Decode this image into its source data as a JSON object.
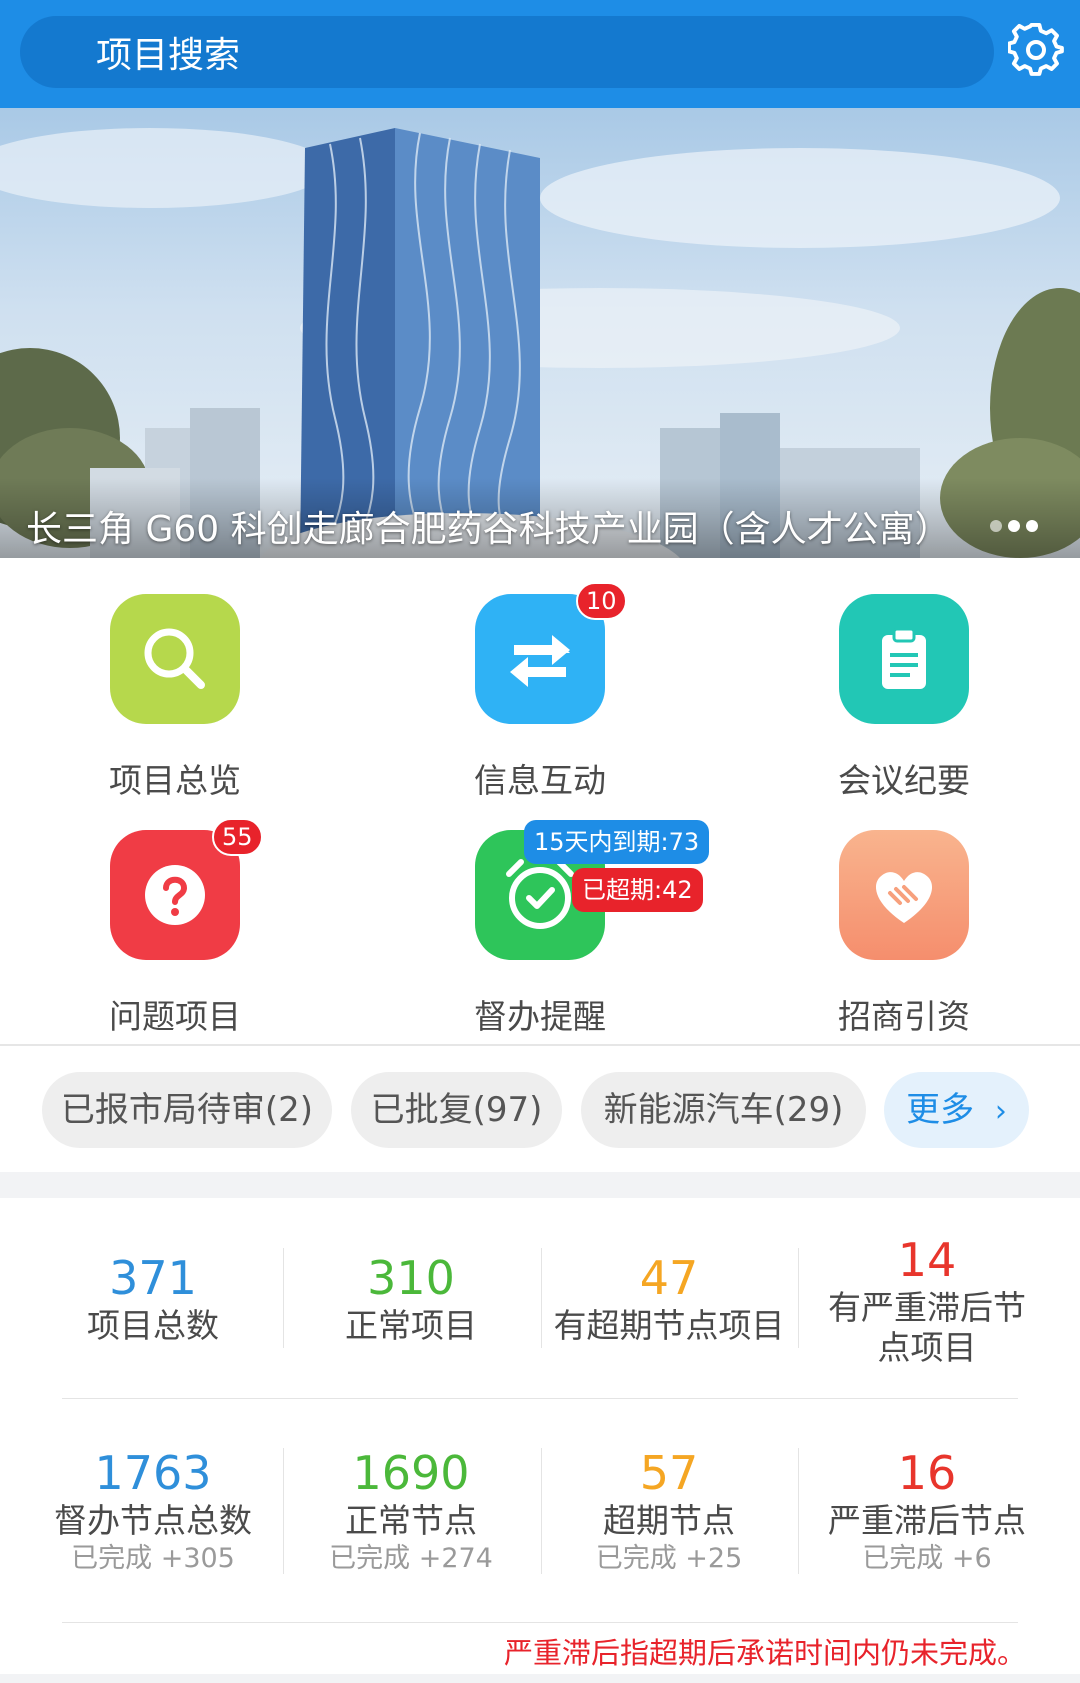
{
  "header": {
    "search_placeholder": "项目搜索",
    "settings_icon": "gear-icon"
  },
  "banner": {
    "title": "长三角 G60 科创走廊合肥药谷科技产业园（含人才公寓）",
    "dots": 3
  },
  "grid": [
    {
      "label": "项目总览",
      "icon": "search-icon",
      "color": "#B6D84C"
    },
    {
      "label": "信息互动",
      "icon": "swap-arrows-icon",
      "color": "#2FB2F5",
      "badge": "10"
    },
    {
      "label": "会议纪要",
      "icon": "clipboard-icon",
      "color": "#22C7B5"
    },
    {
      "label": "问题项目",
      "icon": "question-icon",
      "color": "#F03C45",
      "badge": "55"
    },
    {
      "label": "督办提醒",
      "icon": "alarm-clock-icon",
      "color": "#2EC55A",
      "badge_due": "15天内到期:73",
      "badge_overdue": "已超期:42"
    },
    {
      "label": "招商引资",
      "icon": "handshake-heart-icon",
      "color": "#F7A07D"
    }
  ],
  "tags": [
    {
      "label": "已报市局待审(2)"
    },
    {
      "label": "已批复(97)"
    },
    {
      "label": "新能源汽车(29)"
    },
    {
      "label": "更多",
      "icon": "chevron-right-icon"
    }
  ],
  "stats_projects": [
    {
      "value": "371",
      "label": "项目总数",
      "color": "#2F8FDA"
    },
    {
      "value": "310",
      "label": "正常项目",
      "color": "#4BB83A"
    },
    {
      "value": "47",
      "label": "有超期节点项目",
      "color": "#F5A623"
    },
    {
      "value": "14",
      "label": "有严重滞后节点项目",
      "color": "#E8352C"
    }
  ],
  "stats_nodes": [
    {
      "value": "1763",
      "label": "督办节点总数",
      "sub": "已完成 +305",
      "color": "#2F8FDA"
    },
    {
      "value": "1690",
      "label": "正常节点",
      "sub": "已完成 +274",
      "color": "#4BB83A"
    },
    {
      "value": "57",
      "label": "超期节点",
      "sub": "已完成 +25",
      "color": "#F5A623"
    },
    {
      "value": "16",
      "label": "严重滞后节点",
      "sub": "已完成 +6",
      "color": "#E8352C"
    }
  ],
  "footnote": "严重滞后指超期后承诺时间内仍未完成。"
}
